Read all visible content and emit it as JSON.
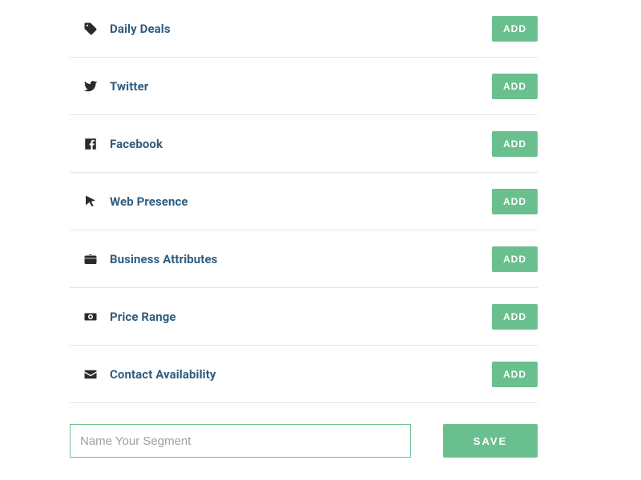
{
  "segments": [
    {
      "id": "daily-deals",
      "label": "Daily Deals",
      "icon": "tag-icon",
      "add_label": "ADD"
    },
    {
      "id": "twitter",
      "label": "Twitter",
      "icon": "twitter-icon",
      "add_label": "ADD"
    },
    {
      "id": "facebook",
      "label": "Facebook",
      "icon": "facebook-icon",
      "add_label": "ADD"
    },
    {
      "id": "web-presence",
      "label": "Web Presence",
      "icon": "cursor-icon",
      "add_label": "ADD"
    },
    {
      "id": "business-attr",
      "label": "Business Attributes",
      "icon": "briefcase-icon",
      "add_label": "ADD"
    },
    {
      "id": "price-range",
      "label": "Price Range",
      "icon": "money-icon",
      "add_label": "ADD"
    },
    {
      "id": "contact-avail",
      "label": "Contact Availability",
      "icon": "mail-icon",
      "add_label": "ADD"
    }
  ],
  "footer": {
    "placeholder": "Name Your Segment",
    "value": "",
    "save_label": "SAVE"
  },
  "colors": {
    "accent": "#6abf8f",
    "label": "#2f5d80",
    "icon": "#2b2b2b"
  }
}
